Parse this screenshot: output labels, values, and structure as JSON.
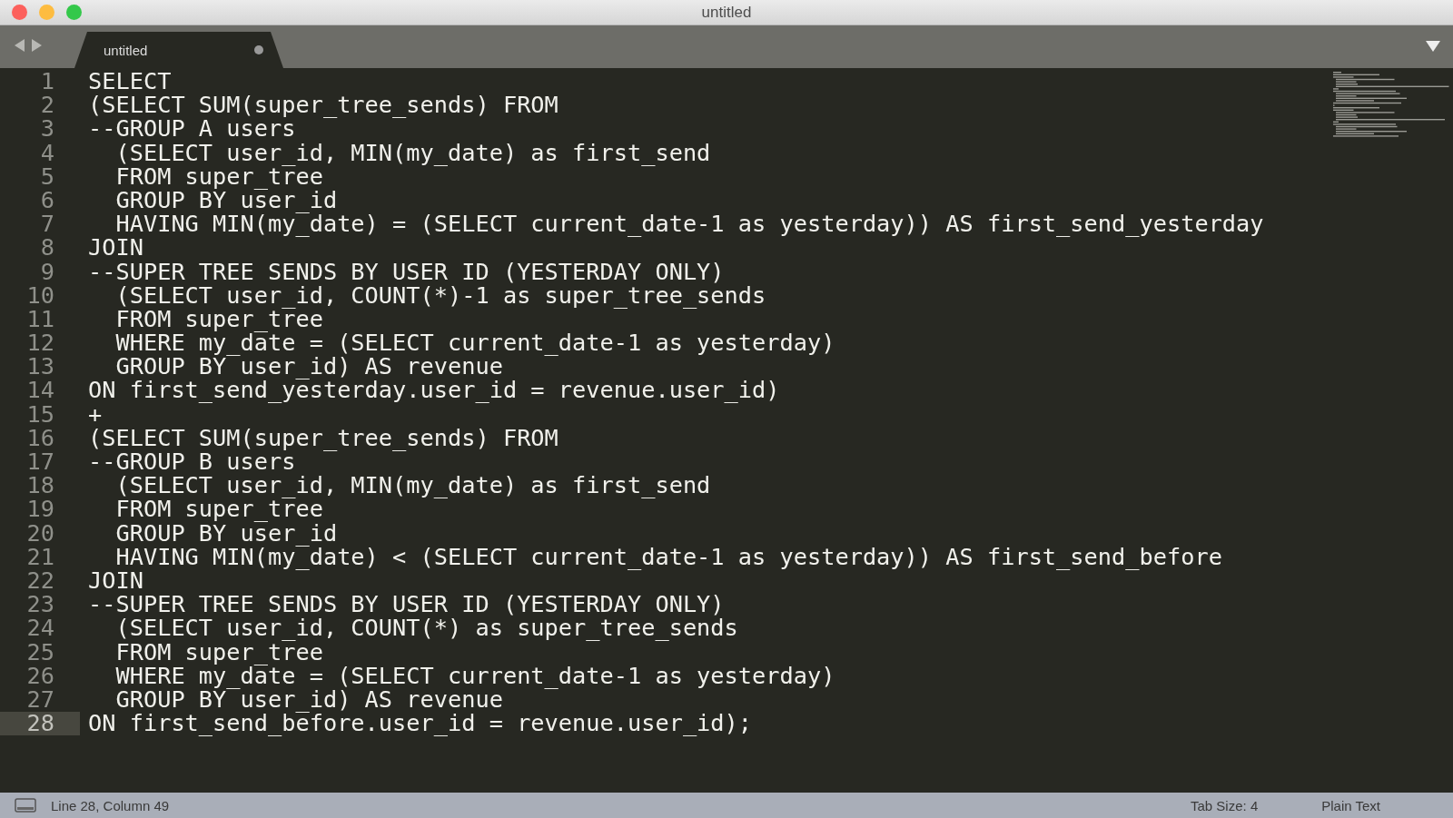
{
  "window": {
    "title": "untitled"
  },
  "tabs": [
    {
      "label": "untitled",
      "selected": true,
      "modified": true
    }
  ],
  "editor": {
    "lines": [
      {
        "number": "1",
        "text": "SELECT",
        "current": false
      },
      {
        "number": "2",
        "text": "(SELECT SUM(super_tree_sends) FROM",
        "current": false
      },
      {
        "number": "3",
        "text": "--GROUP A users",
        "current": false
      },
      {
        "number": "4",
        "text": "  (SELECT user_id, MIN(my_date) as first_send",
        "current": false
      },
      {
        "number": "5",
        "text": "  FROM super_tree",
        "current": false
      },
      {
        "number": "6",
        "text": "  GROUP BY user_id",
        "current": false
      },
      {
        "number": "7",
        "text": "  HAVING MIN(my_date) = (SELECT current_date-1 as yesterday)) AS first_send_yesterday",
        "current": false
      },
      {
        "number": "8",
        "text": "JOIN",
        "current": false
      },
      {
        "number": "9",
        "text": "--SUPER TREE SENDS BY USER ID (YESTERDAY ONLY)",
        "current": false
      },
      {
        "number": "10",
        "text": "  (SELECT user_id, COUNT(*)-1 as super_tree_sends",
        "current": false
      },
      {
        "number": "11",
        "text": "  FROM super_tree",
        "current": false
      },
      {
        "number": "12",
        "text": "  WHERE my_date = (SELECT current_date-1 as yesterday)",
        "current": false
      },
      {
        "number": "13",
        "text": "  GROUP BY user_id) AS revenue",
        "current": false
      },
      {
        "number": "14",
        "text": "ON first_send_yesterday.user_id = revenue.user_id)",
        "current": false
      },
      {
        "number": "15",
        "text": "+",
        "current": false
      },
      {
        "number": "16",
        "text": "(SELECT SUM(super_tree_sends) FROM",
        "current": false
      },
      {
        "number": "17",
        "text": "--GROUP B users",
        "current": false
      },
      {
        "number": "18",
        "text": "  (SELECT user_id, MIN(my_date) as first_send",
        "current": false
      },
      {
        "number": "19",
        "text": "  FROM super_tree",
        "current": false
      },
      {
        "number": "20",
        "text": "  GROUP BY user_id",
        "current": false
      },
      {
        "number": "21",
        "text": "  HAVING MIN(my_date) < (SELECT current_date-1 as yesterday)) AS first_send_before",
        "current": false
      },
      {
        "number": "22",
        "text": "JOIN",
        "current": false
      },
      {
        "number": "23",
        "text": "--SUPER TREE SENDS BY USER ID (YESTERDAY ONLY)",
        "current": false
      },
      {
        "number": "24",
        "text": "  (SELECT user_id, COUNT(*) as super_tree_sends",
        "current": false
      },
      {
        "number": "25",
        "text": "  FROM super_tree",
        "current": false
      },
      {
        "number": "26",
        "text": "  WHERE my_date = (SELECT current_date-1 as yesterday)",
        "current": false
      },
      {
        "number": "27",
        "text": "  GROUP BY user_id) AS revenue",
        "current": false
      },
      {
        "number": "28",
        "text": "ON first_send_before.user_id = revenue.user_id);",
        "current": true
      }
    ]
  },
  "status_bar": {
    "position": "Line 28, Column 49",
    "tab_size": "Tab Size: 4",
    "syntax": "Plain Text"
  }
}
